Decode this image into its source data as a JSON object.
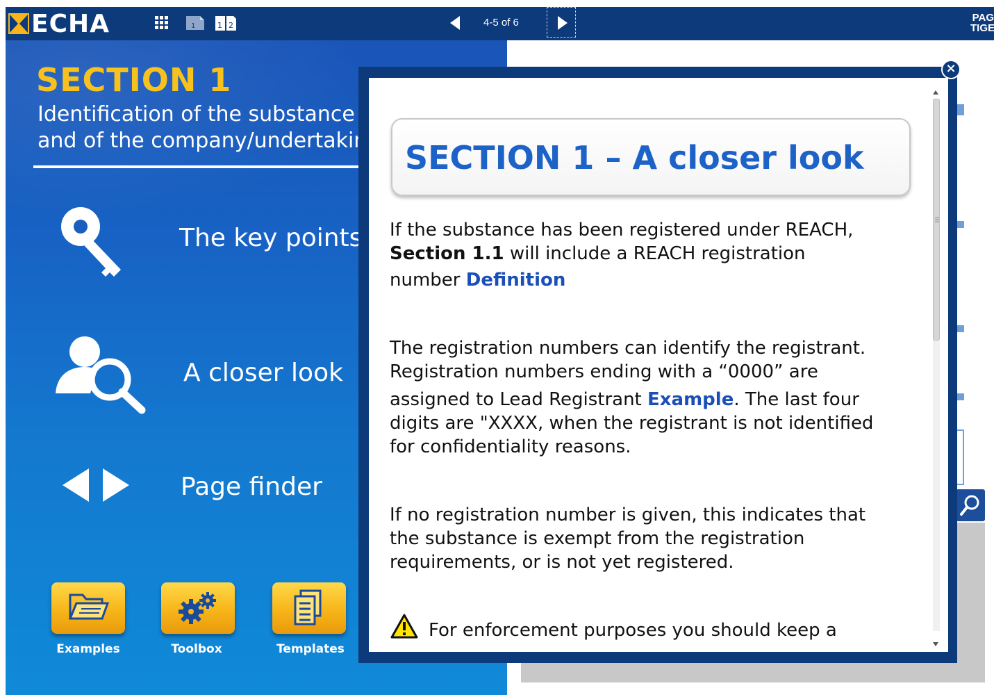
{
  "topbar": {
    "logo_text": "ECHA",
    "page_indicator": "4-5 of 6",
    "brand_right_line1": "PAG",
    "brand_right_line2": "TIGE"
  },
  "left_panel": {
    "section_title": "SECTION 1",
    "section_subtitle_line1": "Identification of the substance",
    "section_subtitle_line2": "and of the company/undertaking",
    "menu": [
      {
        "label": "The key points",
        "icon": "key-icon"
      },
      {
        "label": "A closer look",
        "icon": "person-magnifier-icon"
      },
      {
        "label": "Page finder",
        "icon": "left-right-arrows-icon"
      }
    ],
    "tools": [
      {
        "label": "Examples",
        "icon": "folder-icon"
      },
      {
        "label": "Toolbox",
        "icon": "gears-icon"
      },
      {
        "label": "Templates",
        "icon": "documents-icon"
      }
    ]
  },
  "modal": {
    "close_label": "×",
    "title": "SECTION 1 – A closer look",
    "p1_text_a": "If the substance has been registered under REACH,",
    "p1_bold": "Section 1.1",
    "p1_text_b": " will include a REACH registration",
    "p1_text_c": "number ",
    "p1_link": "Definition",
    "p2_line1": "The registration numbers can identify the registrant.",
    "p2_line2": "Registration numbers ending with a “0000” are",
    "p2_text_a": "assigned to Lead Registrant ",
    "p2_link": "Example",
    "p2_text_b": ". The last four",
    "p2_line4": "digits are \"XXXX, when the registrant is not identified",
    "p2_line5": "for confidentiality reasons.",
    "p3_line1": "If no registration number is given, this indicates that",
    "p3_line2": "the substance is exempt from the registration",
    "p3_line3": "requirements, or is not yet registered.",
    "warning_text": "For enforcement purposes you should keep a"
  },
  "colors": {
    "navy": "#0d3a7a",
    "accent_yellow": "#f7c21e",
    "link_blue": "#1b4fb8",
    "title_blue": "#1c62c7"
  }
}
